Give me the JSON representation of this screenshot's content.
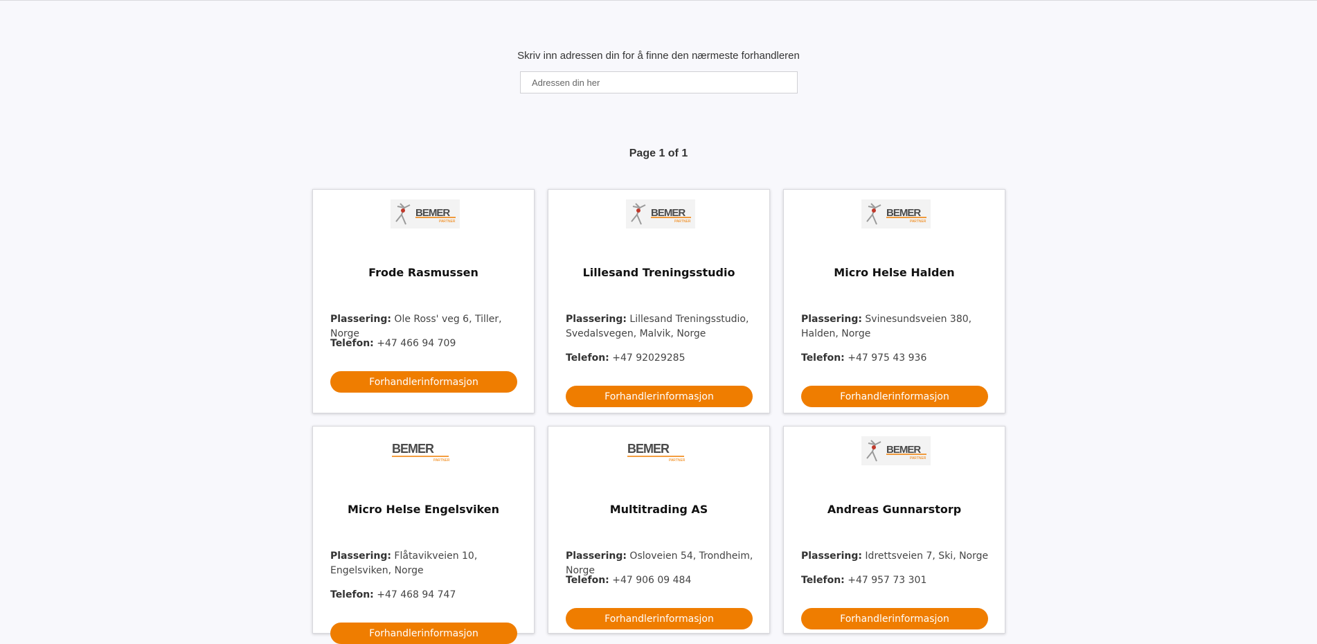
{
  "search": {
    "prompt": "Skriv inn adressen din for å finne den nærmeste forhandleren",
    "placeholder": "Adressen din her"
  },
  "pagination": {
    "label": "Page 1 of 1"
  },
  "labels": {
    "location": "Plassering:",
    "phone": "Telefon:"
  },
  "logo": {
    "brand": "BEMER",
    "tag": "PARTNER",
    "brand_color": "#4a4a4a",
    "accent_color": "#ef7d00"
  },
  "dealers": [
    {
      "name": "Frode Rasmussen",
      "address": "Ole Ross' veg 6, Tiller, Norge",
      "phone": "+47 466 94 709",
      "button": "Forhandlerinformasjon",
      "logo_variant": "figure"
    },
    {
      "name": "Lillesand Treningsstudio",
      "address": "Lillesand Treningsstudio, Svedalsvegen, Malvik, Norge",
      "phone": "+47 92029285",
      "button": "Forhandlerinformasjon",
      "logo_variant": "figure"
    },
    {
      "name": "Micro Helse Halden",
      "address": "Svinesundsveien 380, Halden, Norge",
      "phone": "+47 975 43 936",
      "button": "Forhandlerinformasjon",
      "logo_variant": "figure"
    },
    {
      "name": "Micro Helse Engelsviken",
      "address": "Flåtavikveien 10, Engelsviken, Norge",
      "phone": "+47 468 94 747",
      "button": "Forhandlerinformasjon",
      "logo_variant": "text"
    },
    {
      "name": "Multitrading AS",
      "address": "Osloveien 54, Trondheim, Norge",
      "phone": "+47 906 09 484",
      "button": "Forhandlerinformasjon",
      "logo_variant": "text"
    },
    {
      "name": "Andreas Gunnarstorp",
      "address": "Idrettsveien 7, Ski, Norge",
      "phone": "+47 957 73 301",
      "button": "Forhandlerinformasjon",
      "logo_variant": "figure"
    }
  ]
}
